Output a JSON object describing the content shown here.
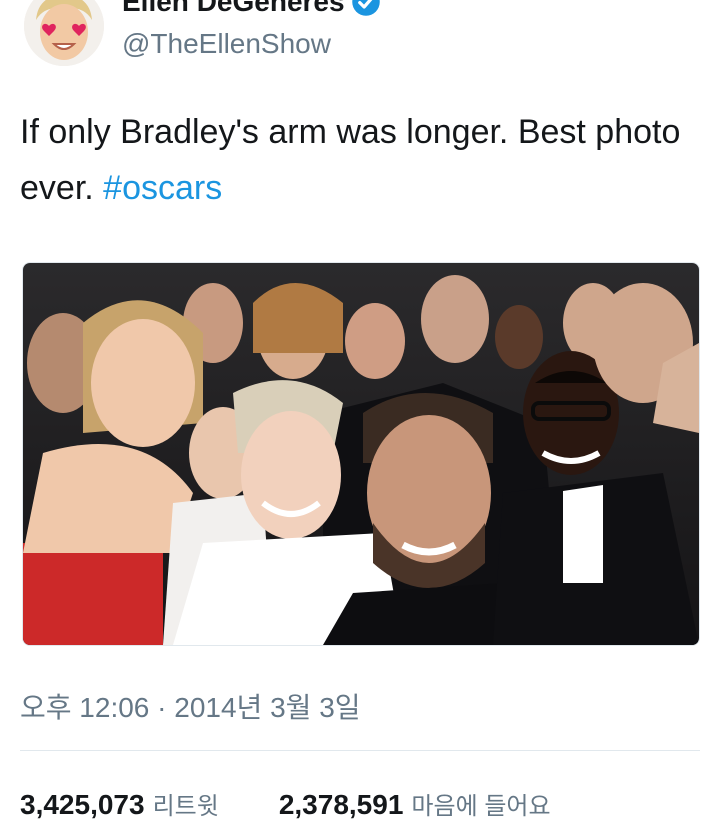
{
  "profile": {
    "name": "Ellen DeGeneres",
    "handle": "@TheEllenShow",
    "avatar_icon": "ellen-heart-eyes-emoji-avatar",
    "verified_icon": "verified-badge-icon"
  },
  "tweet": {
    "text_before": "If only Bradley's arm was longer. Best photo ever. ",
    "hashtag": "#oscars"
  },
  "image": {
    "alt_icon": "group-selfie-photo"
  },
  "meta": {
    "timestamp": "오후 12:06 · 2014년 3월 3일"
  },
  "stats": {
    "retweets_count": "3,425,073",
    "retweets_label": "리트윗",
    "likes_count": "2,378,591",
    "likes_label": "마음에 들어요"
  },
  "colors": {
    "link": "#1b95e0",
    "secondary_text": "#657786",
    "primary_text": "#14171a",
    "divider": "#e1e8ed"
  }
}
